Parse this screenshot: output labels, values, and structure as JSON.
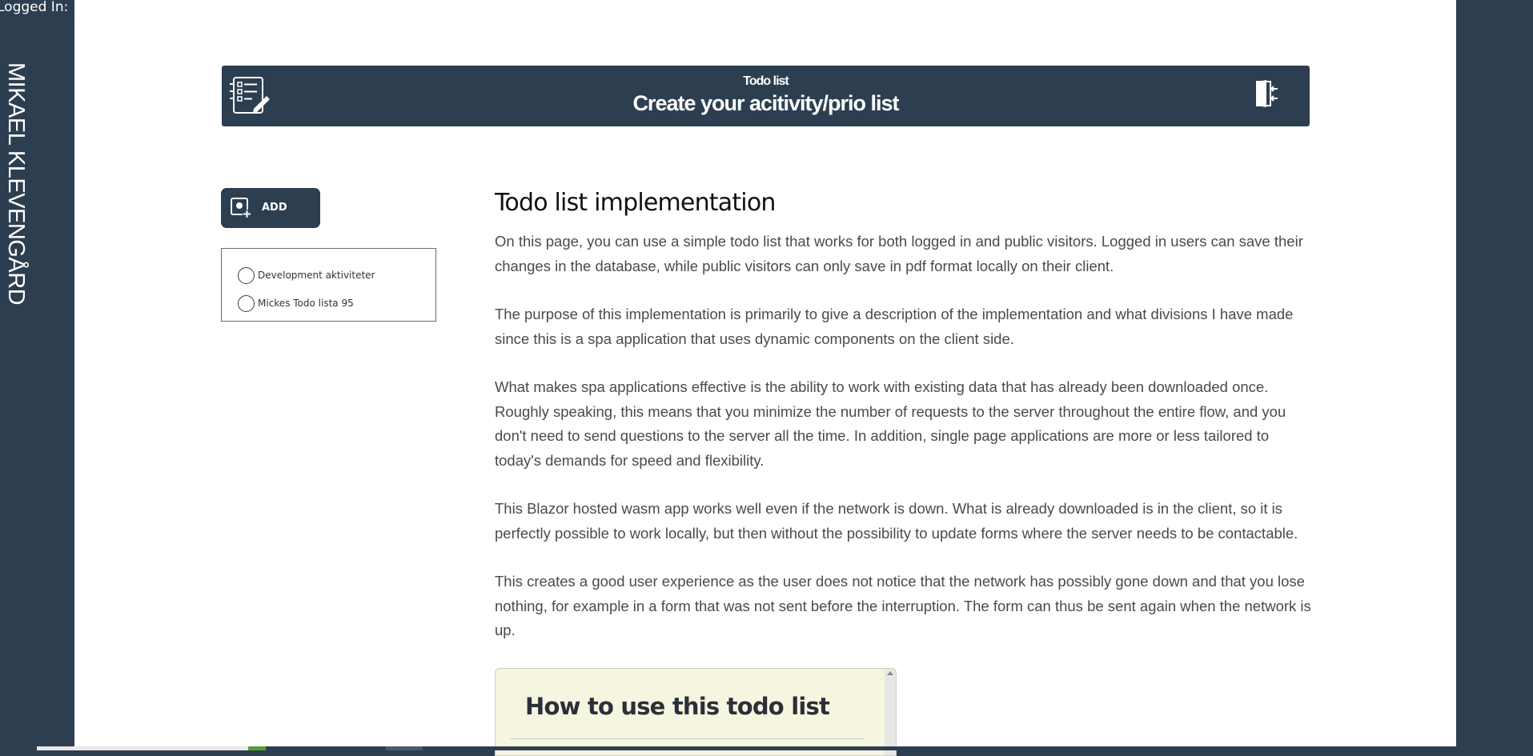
{
  "sidebar": {
    "logged_in_label": "Logged In:",
    "user_name": "MIKAEL KLEVENGÅRD"
  },
  "header": {
    "subtitle": "Todo list",
    "title": "Create your acitivity/prio list",
    "left_icon": "checklist-edit-icon",
    "right_icon": "logout-door-icon"
  },
  "toolbar": {
    "add_label": "ADD",
    "add_icon": "add-image-icon"
  },
  "todo_lists": [
    {
      "label": "Development aktiviteter"
    },
    {
      "label": "Mickes Todo lista 95"
    }
  ],
  "content": {
    "title": "Todo list implementation",
    "paragraphs": [
      "On this page, you can use a simple todo list that works for both logged in and public visitors. Logged in users can save their changes in the database, while public visitors can only save in pdf format locally on their client.",
      "The purpose of this implementation is primarily to give a description of the implementation and what divisions I have made since this is a spa application that uses dynamic components on the client side.",
      "What makes spa applications effective is the ability to work with existing data that has already been downloaded once. Roughly speaking, this means that you minimize the number of requests to the server throughout the entire flow, and you don't need to send questions to the server all the time. In addition, single page applications are more or less tailored to today's demands for speed and flexibility.",
      "This Blazor hosted wasm app works well even if the network is down. What is already downloaded is in the client, so it is perfectly possible to work locally, but then without the possibility to update forms where the server needs to be contactable.",
      "This creates a good user experience as the user does not notice that the network has possibly gone down and that you lose nothing, for example in a form that was not sent before the interruption. The form can thus be sent again when the network is up."
    ]
  },
  "help_box": {
    "title": "How to use this todo list"
  },
  "colors": {
    "brand_dark": "#2e3e51",
    "help_bg": "#f6f6e0",
    "body_text": "#4a4a4a"
  }
}
